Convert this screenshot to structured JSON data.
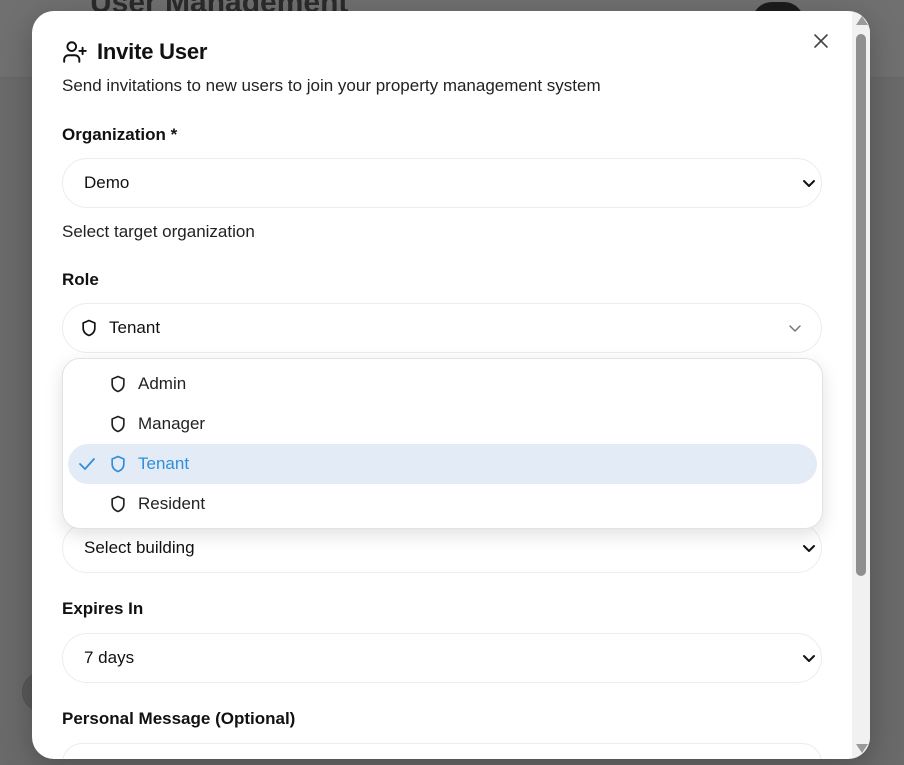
{
  "background": {
    "page_title": "User Management"
  },
  "modal": {
    "title": "Invite User",
    "subtitle": "Send invitations to new users to join your property management system",
    "organization": {
      "label": "Organization *",
      "value": "Demo",
      "helper": "Select target organization"
    },
    "role": {
      "label": "Role",
      "value": "Tenant",
      "options": [
        {
          "label": "Admin",
          "selected": false
        },
        {
          "label": "Manager",
          "selected": false
        },
        {
          "label": "Tenant",
          "selected": true
        },
        {
          "label": "Resident",
          "selected": false
        }
      ]
    },
    "building": {
      "value": "Select building"
    },
    "expires": {
      "label": "Expires In",
      "value": "7 days"
    },
    "message": {
      "label": "Personal Message (Optional)"
    }
  },
  "colors": {
    "accent": "#2f8fd8",
    "selected_bg": "#e3ebf7",
    "overlay": "#5e5e5e"
  },
  "icons": {
    "title": "user-plus-icon",
    "close": "close-icon",
    "role": "shield-icon",
    "check": "check-icon",
    "chevron": "chevron-down-icon"
  }
}
